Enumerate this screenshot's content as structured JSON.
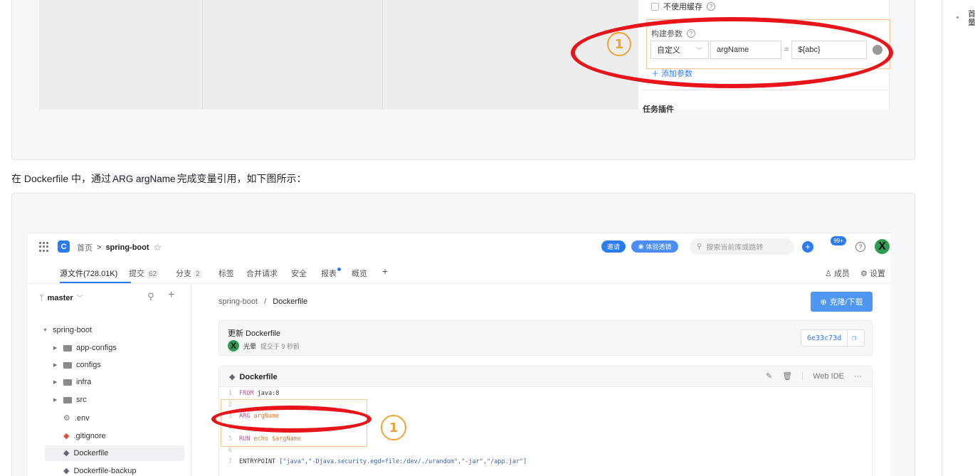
{
  "top_shot": {
    "no_cache_label": "不使用缓存",
    "build_params_label": "构建参数",
    "param_type": "自定义",
    "param_name": "argName",
    "eq": "=",
    "param_value": "${abc}",
    "add_param": "＋ 添加参数",
    "task_label": "任务插件",
    "callout": "1"
  },
  "paragraph": {
    "before": "在 Dockerfile 中，通过",
    "code": "ARG argName",
    "after": "完成变量引用，如下图所示："
  },
  "right_rail": {
    "text": "首量"
  },
  "app": {
    "breadcrumb": {
      "home": "首页",
      "sep": ">",
      "repo": "spring-boot"
    },
    "invite": "邀请",
    "trial": "体验透镜",
    "search_placeholder": "搜索当前库或跳转",
    "notif_badge": "99+",
    "avatar_letter": "X",
    "tabs": [
      {
        "label": "源文件(728.01K)"
      },
      {
        "label": "提交",
        "count": "62"
      },
      {
        "label": "分支",
        "count": "2"
      },
      {
        "label": "标签"
      },
      {
        "label": "合并请求"
      },
      {
        "label": "安全"
      },
      {
        "label": "报表"
      },
      {
        "label": "概览"
      },
      {
        "label": "+"
      }
    ],
    "members": "成员",
    "settings": "设置",
    "branch": "master",
    "tree": [
      {
        "name": "spring-boot"
      },
      {
        "name": "app-configs"
      },
      {
        "name": "configs"
      },
      {
        "name": "infra"
      },
      {
        "name": "src"
      },
      {
        "name": ".env"
      },
      {
        "name": ".gitignore"
      },
      {
        "name": "Dockerfile"
      },
      {
        "name": "Dockerfile-backup"
      }
    ],
    "path": {
      "repo": "spring-boot",
      "sep": "/",
      "file": "Dockerfile"
    },
    "clone_button": "克隆/下载",
    "commit": {
      "title": "更新 Dockerfile",
      "author": "光晕",
      "time": "提交于 9 秒前",
      "hash": "6e33c73d"
    },
    "file": {
      "name": "Dockerfile",
      "web_ide": "Web IDE",
      "more": "···",
      "lines": [
        {
          "n": "1",
          "kw": "FROM",
          "rest": " java:8"
        },
        {
          "n": "2",
          "kw": "",
          "rest": ""
        },
        {
          "n": "3",
          "kw": "ARG",
          "rest": " argName"
        },
        {
          "n": "4",
          "kw": "",
          "rest": ""
        },
        {
          "n": "5",
          "kw": "RUN",
          "rest": " echo $argName"
        },
        {
          "n": "6",
          "kw": "",
          "rest": ""
        },
        {
          "n": "7",
          "kw": "ENTRYPOINT",
          "rest": " [\"java\",\"-Djava.security.egd=file:/dev/./urandom\",\"-jar\",\"/app.jar\"]"
        }
      ]
    },
    "callout": "1"
  }
}
